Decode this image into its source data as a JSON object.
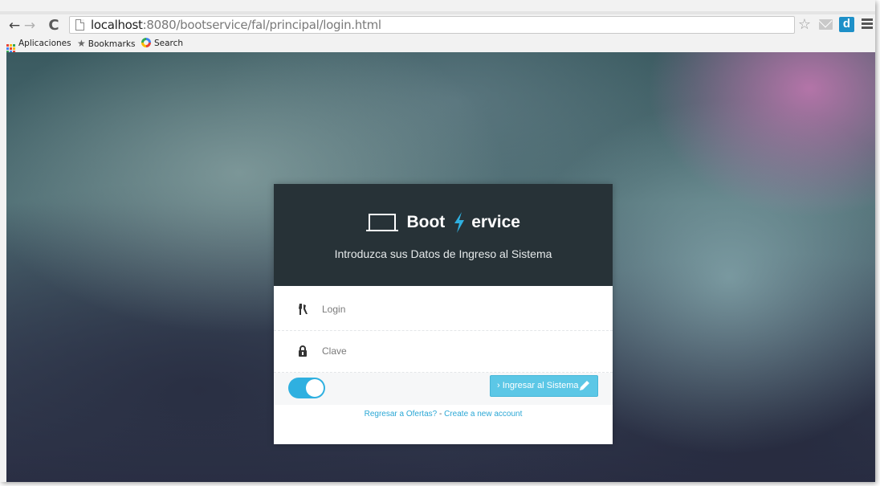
{
  "browser": {
    "url_host": "localhost",
    "url_rest": ":8080/bootservice/fal/principal/login.html",
    "extension_label": "d",
    "bookmarks": [
      {
        "label": "Aplicaciones",
        "icon": "apps-grid-icon"
      },
      {
        "label": "Bookmarks",
        "icon": "star-icon"
      },
      {
        "label": "Search",
        "icon": "search-icon"
      }
    ]
  },
  "login_card": {
    "brand_left": "Boot",
    "brand_right": "ervice",
    "subtitle": "Introduzca sus Datos de Ingreso al Sistema",
    "login_placeholder": "Login",
    "password_placeholder": "Clave",
    "toggle_on": true,
    "submit_label": "› Ingresar al Sistema",
    "back_link": "Regresar a Ofertas?",
    "separator": "-",
    "create_link": "Create a new account"
  },
  "colors": {
    "header_bg": "#273237",
    "accent": "#2fb0e0",
    "button": "#5cc7e6",
    "bolt": "#2fb0e0",
    "link": "#2aa7d5"
  }
}
